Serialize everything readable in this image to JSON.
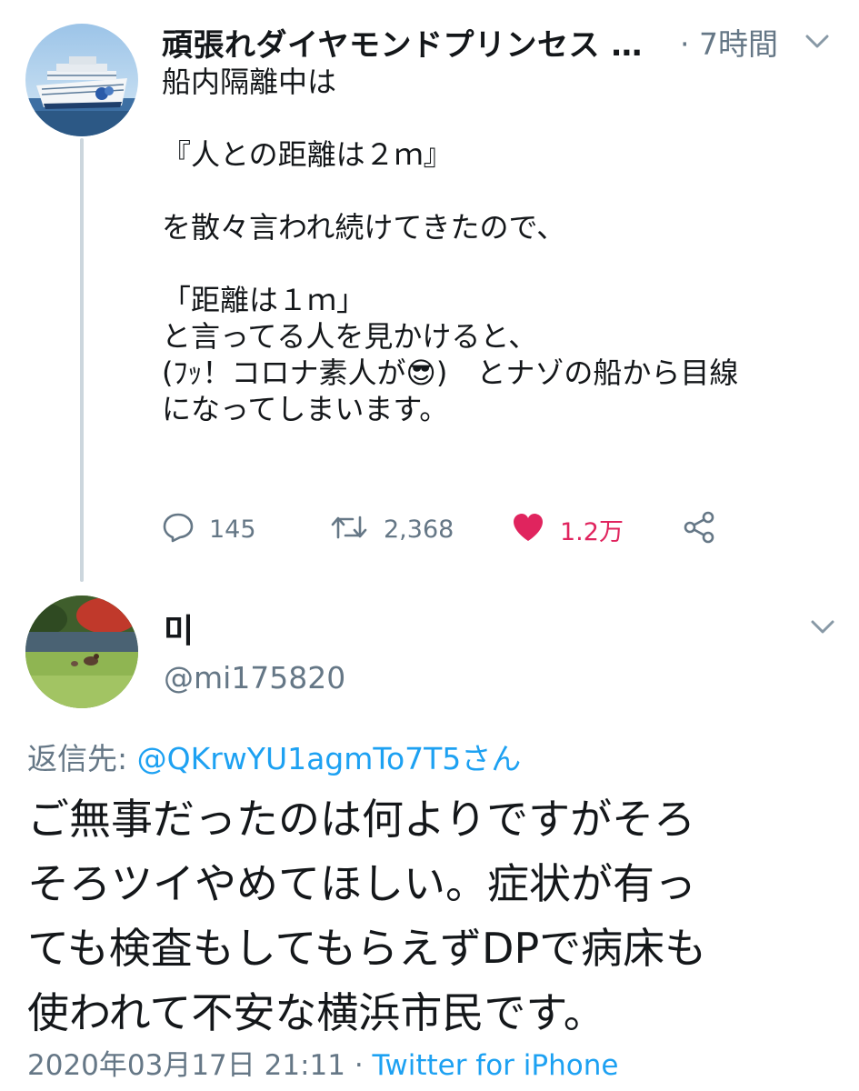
{
  "tweet1": {
    "display_name": "頑張れダイヤモンドプリンセス …",
    "time": "· 7時間",
    "body": "船内隔離中は\n\n『人との距離は２ｍ』\n\nを散々言われ続けてきたので、\n\n「距離は１ｍ」\nと言ってる人を見かけると、\n(ﾌｯ！コロナ素人が😎)　とナゾの船から目線\nになってしまいます。",
    "actions": {
      "reply_count": "145",
      "retweet_count": "2,368",
      "like_count": "1.2万"
    }
  },
  "tweet2": {
    "display_name": "미",
    "handle": "@mi175820",
    "reply_label": "返信先: ",
    "reply_handle": "@QKrwYU1agmTo7T5さん",
    "body": "ご無事だったのは何よりですがそろ\nそろツイやめてほしい。症状が有っ\nても検査もしてもらえずDPで病床も\n使われて不安な横浜市民です。",
    "timestamp": "2020年03月17日 21:11 · ",
    "source": "Twitter for iPhone"
  },
  "colors": {
    "text": "#14171a",
    "secondary": "#657786",
    "link": "#1da1f2",
    "like": "#e0245e",
    "thread_line": "#ccd6dd"
  },
  "icons": [
    "chevron-down-icon",
    "reply-icon",
    "retweet-icon",
    "heart-icon",
    "share-icon"
  ]
}
